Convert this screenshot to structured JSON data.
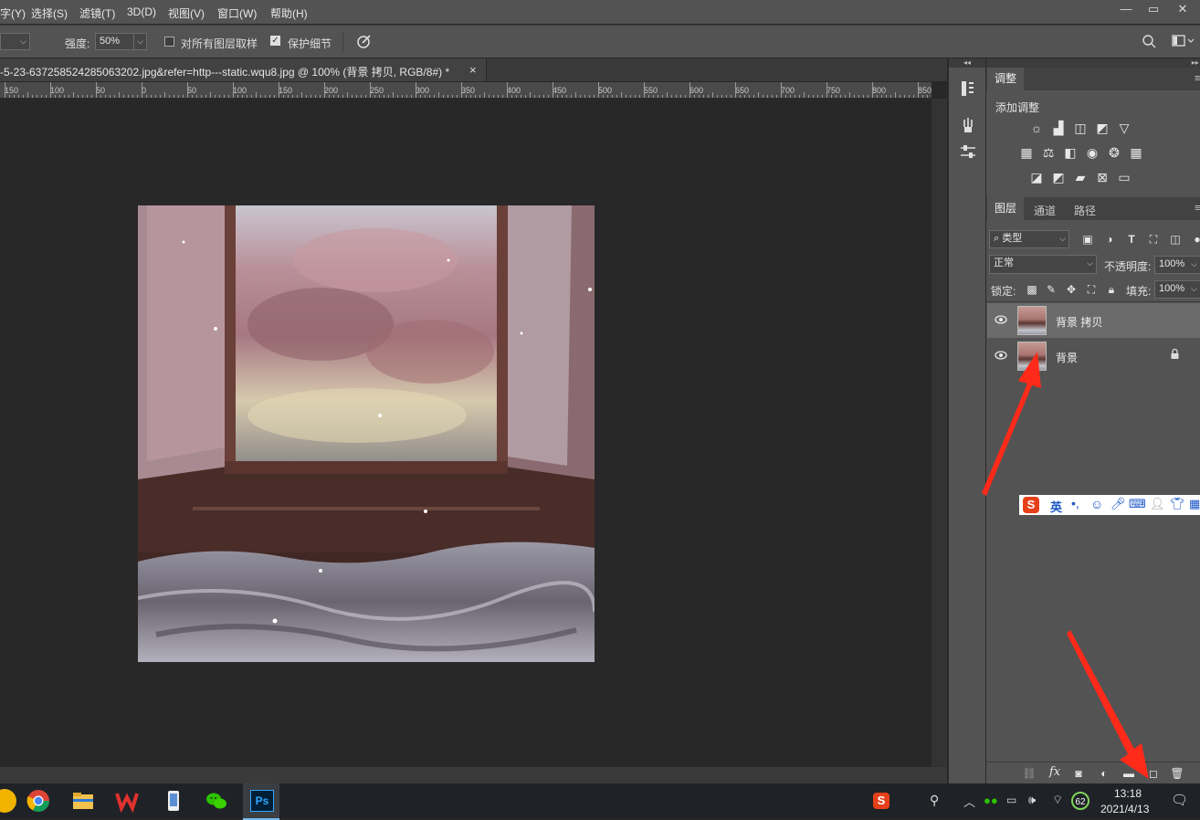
{
  "menu": {
    "items": [
      "字(Y)",
      "选择(S)",
      "滤镜(T)",
      "3D(D)",
      "视图(V)",
      "窗口(W)",
      "帮助(H)"
    ],
    "window_controls": [
      "minimize-icon",
      "restore-icon",
      "close-icon"
    ]
  },
  "options": {
    "strength_label": "强度:",
    "strength_value": "50%",
    "sample_all_label": "对所有图层取样",
    "sample_all_checked": false,
    "protect_detail_label": "保护细节",
    "protect_detail_checked": true
  },
  "document": {
    "tab_title": "-5-23-637258524285063202.jpg&refer=http---static.wqu8.jpg @ 100% (背景 拷贝, RGB/8#) *",
    "close": "×"
  },
  "ruler": {
    "labels": [
      "150",
      "100",
      "50",
      "0",
      "50",
      "100",
      "150",
      "200",
      "250",
      "300",
      "350",
      "400",
      "450",
      "500",
      "550",
      "600",
      "650",
      "700",
      "750",
      "800",
      "850"
    ]
  },
  "adjustments_panel": {
    "tab": "调整",
    "subtitle": "添加调整",
    "icons_row1": [
      "brightness-icon",
      "levels-icon",
      "curves-icon",
      "exposure-icon",
      "vibrance-icon"
    ],
    "icons_row2": [
      "hue-saturation-icon",
      "color-balance-icon",
      "black-white-icon",
      "photo-filter-icon",
      "channel-mixer-icon",
      "color-lookup-icon"
    ],
    "icons_row3": [
      "invert-icon",
      "posterize-icon",
      "threshold-icon",
      "selective-color-icon",
      "gradient-map-icon"
    ]
  },
  "layers_panel": {
    "tabs": [
      "图层",
      "通道",
      "路径"
    ],
    "active_tab": "图层",
    "filter_kind": "类型",
    "blend_mode": "正常",
    "opacity_label": "不透明度:",
    "opacity_value": "100%",
    "lock_label": "锁定:",
    "fill_label": "填充:",
    "fill_value": "100%",
    "layers": [
      {
        "name": "背景 拷贝",
        "visible": true,
        "selected": true,
        "locked": false
      },
      {
        "name": "背景",
        "visible": true,
        "selected": false,
        "locked": true
      }
    ],
    "footer_icons": [
      "link-icon",
      "fx-icon",
      "mask-icon",
      "adjustment-layer-icon",
      "group-icon",
      "new-layer-icon",
      "trash-icon"
    ],
    "fx_label": "fx"
  },
  "ime_toolbar": {
    "mode": "英"
  },
  "taskbar": {
    "time": "13:18",
    "date": "2021/4/13",
    "battery_badge": "62"
  },
  "colors": {
    "menubar": "#535353",
    "canvas_bg": "#282828",
    "panel_bg": "#535353",
    "selected_layer": "#6b6b6b",
    "annotation_arrow": "#ff2a1a"
  }
}
